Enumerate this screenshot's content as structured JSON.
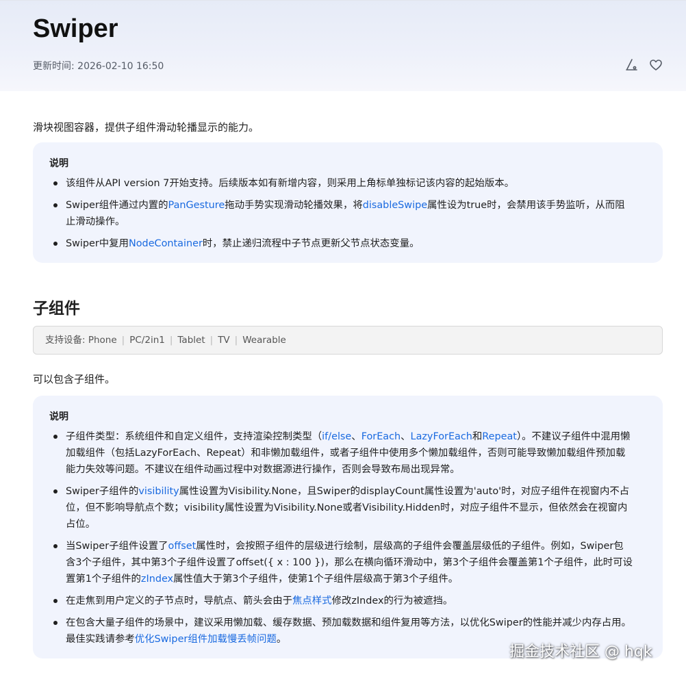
{
  "header": {
    "title": "Swiper",
    "updated": "更新时间: 2026-02-10 16:50",
    "icons": [
      "share-icon",
      "heart-icon"
    ]
  },
  "intro": "滑块视图容器，提供子组件滑动轮播显示的能力。",
  "note1": {
    "title": "说明",
    "items": [
      [
        {
          "t": "该组件从API version 7开始支持。后续版本如有新增内容，则采用上角标单独标记该内容的起始版本。"
        }
      ],
      [
        {
          "t": "Swiper组件通过内置的"
        },
        {
          "t": "PanGesture",
          "link": true
        },
        {
          "t": "拖动手势实现滑动轮播效果，将"
        },
        {
          "t": "disableSwipe",
          "link": true
        },
        {
          "t": "属性设为true时，会禁用该手势监听，从而阻止滑动操作。"
        }
      ],
      [
        {
          "t": "Swiper中复用"
        },
        {
          "t": "NodeContainer",
          "link": true
        },
        {
          "t": "时，禁止递归流程中子节点更新父节点状态变量。"
        }
      ]
    ]
  },
  "section": {
    "title": "子组件",
    "devices_label": "支持设备: ",
    "devices": [
      "Phone",
      "PC/2in1",
      "Tablet",
      "TV",
      "Wearable"
    ],
    "intro": "可以包含子组件。"
  },
  "note2": {
    "title": "说明",
    "items": [
      [
        {
          "t": "子组件类型：系统组件和自定义组件，支持渲染控制类型（"
        },
        {
          "t": "if/else",
          "link": true
        },
        {
          "t": "、"
        },
        {
          "t": "ForEach",
          "link": true
        },
        {
          "t": "、"
        },
        {
          "t": "LazyForEach",
          "link": true
        },
        {
          "t": "和"
        },
        {
          "t": "Repeat",
          "link": true
        },
        {
          "t": "）。不建议子组件中混用懒加载组件（包括LazyForEach、Repeat）和非懒加载组件，或者子组件中使用多个懒加载组件，否则可能导致懒加载组件预加载能力失效等问题。不建议在组件动画过程中对数据源进行操作，否则会导致布局出现异常。"
        }
      ],
      [
        {
          "t": "Swiper子组件的"
        },
        {
          "t": "visibility",
          "link": true
        },
        {
          "t": "属性设置为Visibility.None，且Swiper的displayCount属性设置为'auto'时，对应子组件在视窗内不占位，但不影响导航点个数；visibility属性设置为Visibility.None或者Visibility.Hidden时，对应子组件不显示，但依然会在视窗内占位。"
        }
      ],
      [
        {
          "t": "当Swiper子组件设置了"
        },
        {
          "t": "offset",
          "link": true
        },
        {
          "t": "属性时，会按照子组件的层级进行绘制，层级高的子组件会覆盖层级低的子组件。例如，Swiper包含3个子组件，其中第3个子组件设置了offset({ x : 100 })，那么在横向循环滑动中，第3个子组件会覆盖第1个子组件，此时可设置第1个子组件的"
        },
        {
          "t": "zIndex",
          "link": true
        },
        {
          "t": "属性值大于第3个子组件，使第1个子组件层级高于第3个子组件。"
        }
      ],
      [
        {
          "t": "在走焦到用户定义的子节点时，导航点、箭头会由于"
        },
        {
          "t": "焦点样式",
          "link": true
        },
        {
          "t": "修改zIndex的行为被遮挡。"
        }
      ],
      [
        {
          "t": "在包含大量子组件的场景中，建议采用懒加载、缓存数据、预加载数据和组件复用等方法，以优化Swiper的性能并减少内存占用。最佳实践请参考"
        },
        {
          "t": "优化Swiper组件加载慢丢帧问题",
          "link": true
        },
        {
          "t": "。"
        }
      ]
    ]
  },
  "watermark": "掘金技术社区 @ hqk"
}
